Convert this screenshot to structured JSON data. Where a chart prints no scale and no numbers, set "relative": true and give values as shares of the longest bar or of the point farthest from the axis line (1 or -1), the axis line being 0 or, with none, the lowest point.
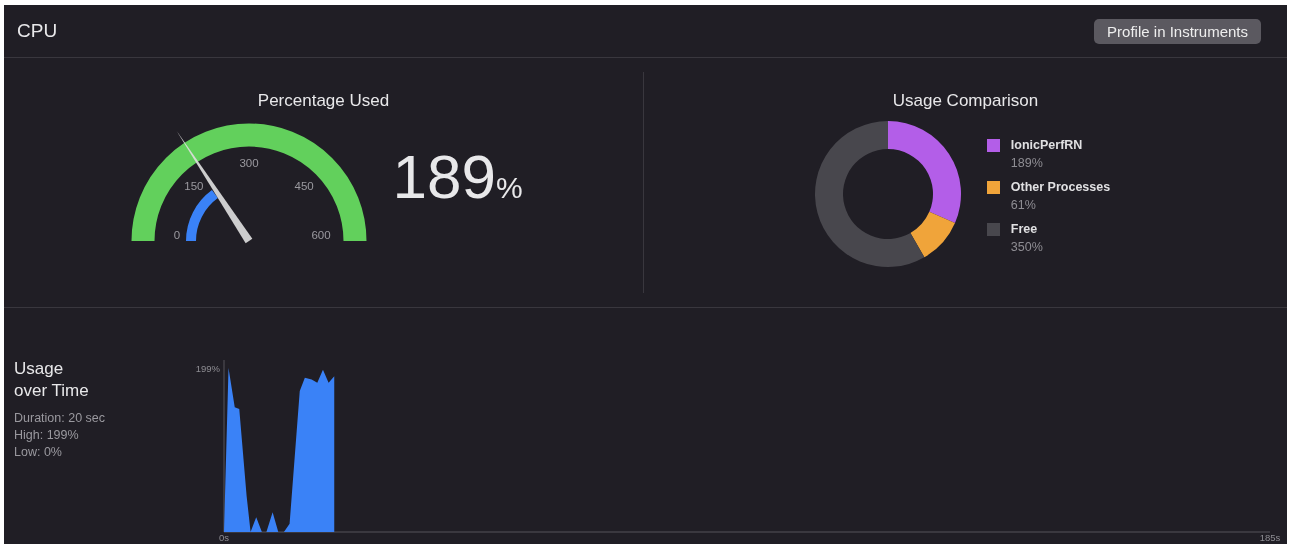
{
  "header": {
    "title": "CPU",
    "button": "Profile in Instruments"
  },
  "gauge": {
    "title": "Percentage Used",
    "ticks": [
      "0",
      "150",
      "300",
      "450",
      "600"
    ],
    "level": 0.315,
    "app_usage": {
      "level": 0.3
    },
    "value": "189",
    "unit": "%"
  },
  "comparison": {
    "title": "Usage Comparison",
    "legend": [
      {
        "value": "189%",
        "color": "#b35ee8"
      },
      {
        "value": "61%",
        "color": "#f0a43a"
      },
      {
        "value": "350%",
        "color": "#48474d"
      }
    ],
    "chart_data": {
      "type": "donut",
      "categories": [
        "IonicPerfRN",
        "Other Processes",
        "Free"
      ],
      "values": [
        31.5,
        10.2,
        58.3
      ]
    }
  },
  "usage": {
    "title": "Usage over Time",
    "stats": [
      "Duration: 20 sec",
      "High: 199%",
      "Low: 0%"
    ],
    "chart_data": {
      "type": "area",
      "relative": true,
      "x": [
        0,
        0.8,
        1.9,
        2.7,
        4.0,
        4.7,
        5.7,
        6.7,
        7.5,
        8.6,
        9.6,
        10.6,
        11.6,
        13.4,
        14.3,
        15.5,
        16.5,
        17.5,
        18.5,
        19.5
      ],
      "series": [
        {
          "color": "#3a82f7",
          "values": [
            0,
            1,
            0.76,
            0.75,
            0.22,
            0,
            0.09,
            0,
            0,
            0.12,
            0,
            0,
            0.05,
            0.86,
            0.94,
            0.93,
            0.91,
            0.99,
            0.91,
            0.95
          ]
        }
      ],
      "xlim": [
        0,
        185
      ],
      "xticks": [
        {
          "value": 0,
          "label": "0s"
        },
        {
          "value": 185,
          "label": "185s"
        }
      ],
      "annotations": [
        {
          "text": "199%"
        }
      ]
    }
  }
}
